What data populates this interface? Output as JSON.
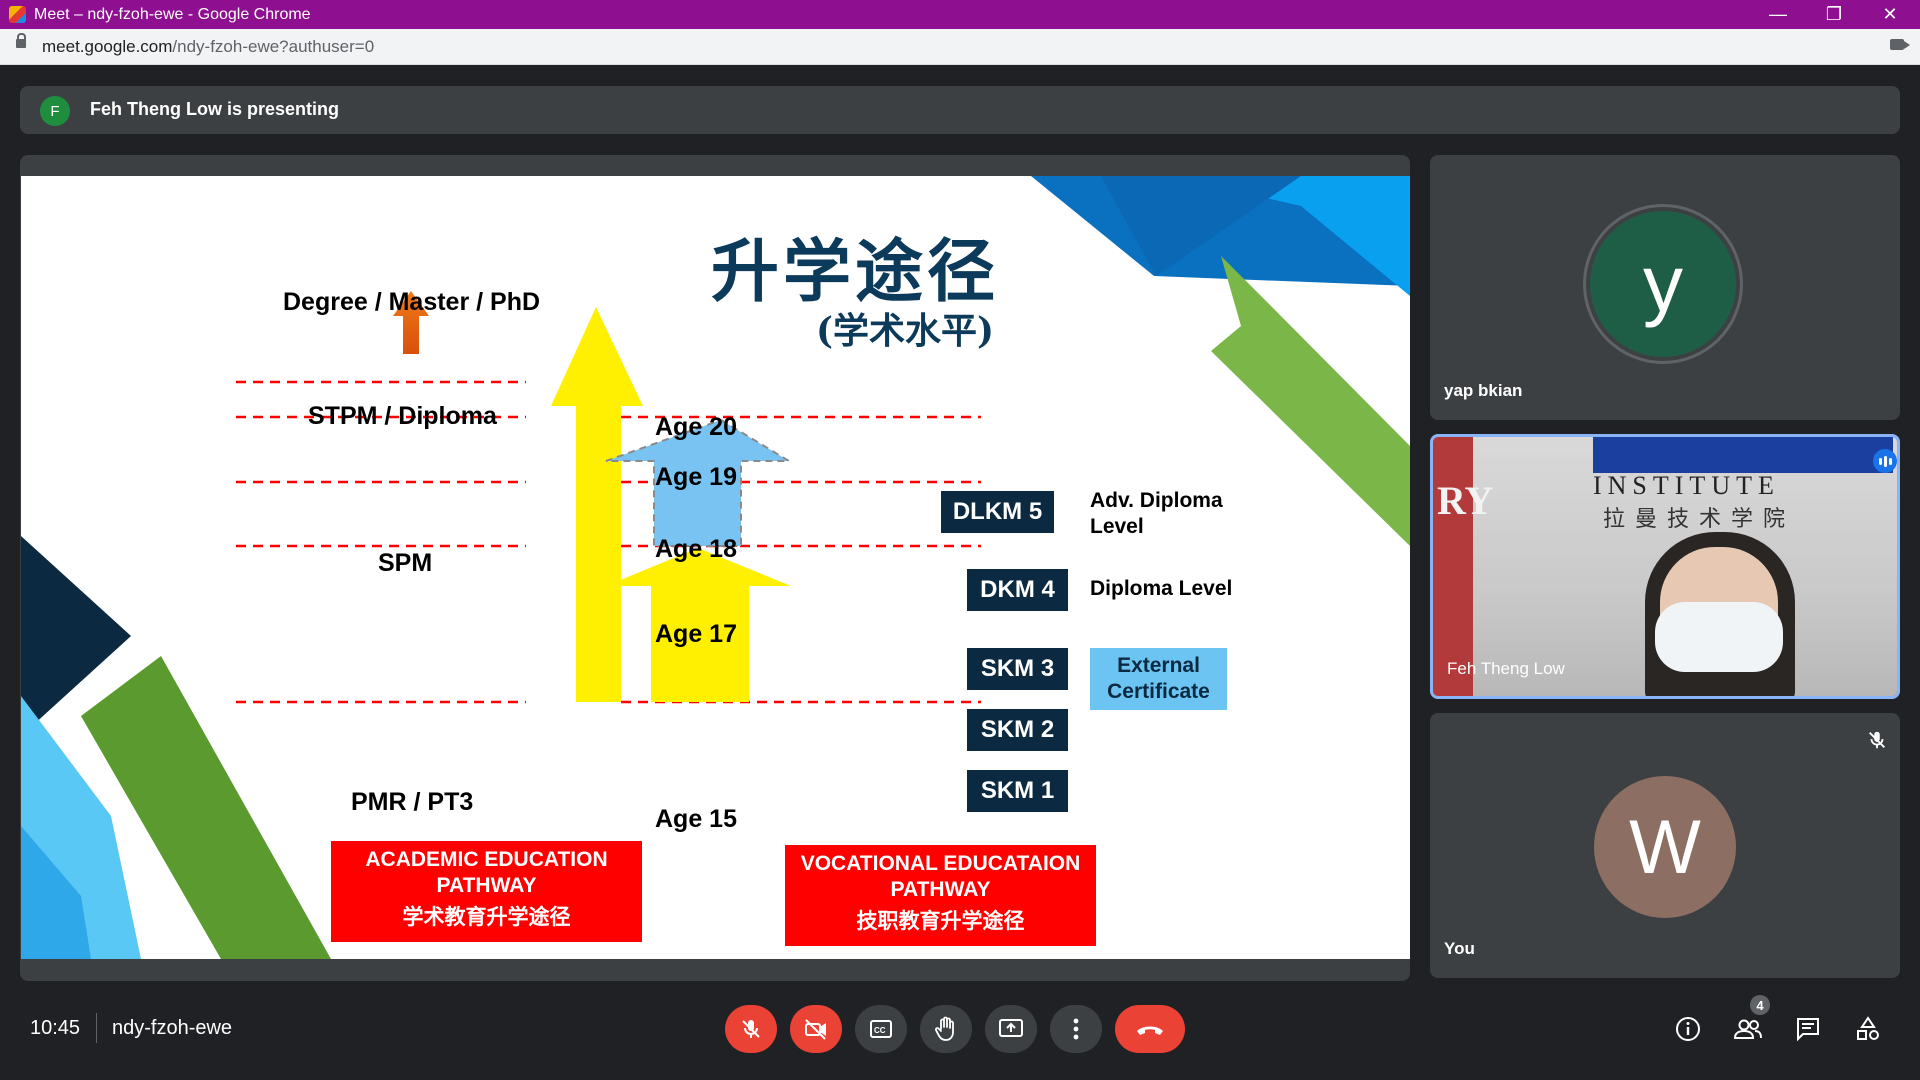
{
  "browser": {
    "window_title": "Meet – ndy-fzoh-ewe - Google Chrome",
    "url_host": "meet.google.com",
    "url_path": "/ndy-fzoh-ewe?authuser=0"
  },
  "banner": {
    "avatar_letter": "F",
    "text": "Feh Theng Low is presenting"
  },
  "slide": {
    "title_cn": "升学途径",
    "subtitle_cn": "(学术水平)",
    "degree": "Degree / Master / PhD",
    "stpm": "STPM / Diploma",
    "spm": "SPM",
    "pmr": "PMR / PT3",
    "ages": [
      "Age 20",
      "Age 19",
      "Age 18",
      "Age 17",
      "Age 15"
    ],
    "levels": [
      "DLKM 5",
      "DKM 4",
      "SKM 3",
      "SKM 2",
      "SKM 1"
    ],
    "level_desc": {
      "dlkm5_line1": "Adv. Diploma",
      "dlkm5_line2": "Level",
      "dkm4": "Diploma Level"
    },
    "external_line1": "External",
    "external_line2": "Certificate",
    "academic_line1": "ACADEMIC EDUCATION",
    "academic_line2": "PATHWAY",
    "academic_cn": "学术教育升学途径",
    "vocational_line1": "VOCATIONAL EDUCATAION",
    "vocational_line2": "PATHWAY",
    "vocational_cn": "技职教育升学途径"
  },
  "participants": [
    {
      "name": "yap bkian",
      "avatar_letter": "y",
      "avatar_color": "#1e5e47"
    },
    {
      "name": "Feh Theng Low",
      "speaking": true,
      "video_text": "INSTITUTE",
      "video_cn": "拉曼技术学院",
      "video_left": "RY"
    },
    {
      "name": "You",
      "avatar_letter": "W",
      "avatar_color": "#8d6e63",
      "muted": true
    }
  ],
  "bottom": {
    "time": "10:45",
    "meeting_code": "ndy-fzoh-ewe",
    "participant_count": "4"
  },
  "icons": {
    "controls": [
      "mic-off-icon",
      "camera-off-icon",
      "captions-icon",
      "raise-hand-icon",
      "present-icon",
      "more-options-icon",
      "end-call-icon"
    ],
    "right": [
      "info-icon",
      "people-icon",
      "chat-icon",
      "activities-icon"
    ]
  },
  "colors": {
    "title_bar": "#8e0f8f",
    "end_call": "#ea4335",
    "speaking_border": "#8ab4f8",
    "slide_title": "#0b3a5a"
  }
}
